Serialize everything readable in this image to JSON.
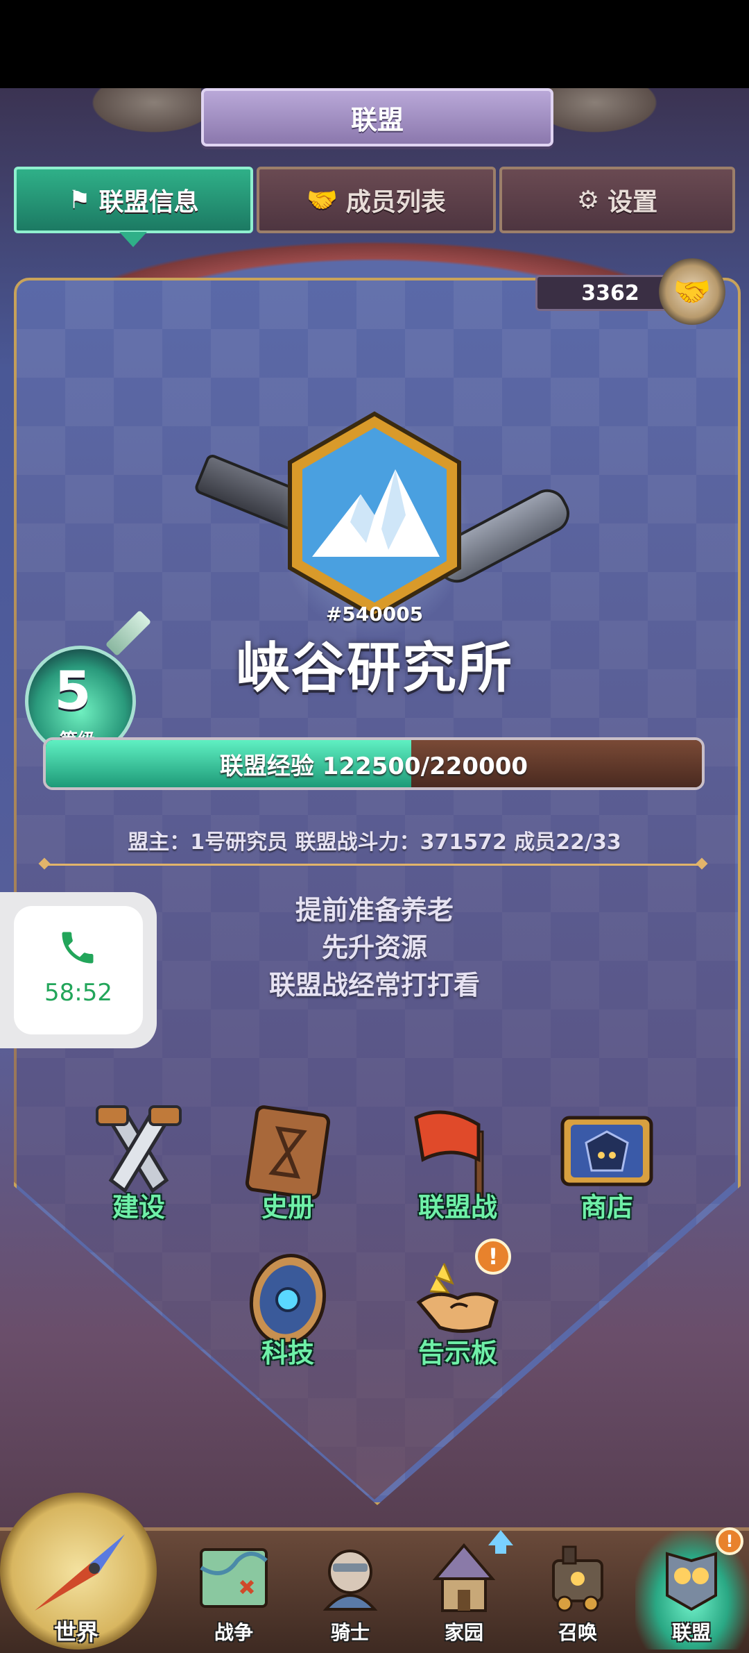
{
  "header": {
    "title": "联盟"
  },
  "tabs": [
    {
      "label": "联盟信息",
      "icon": "flag-icon",
      "active": true
    },
    {
      "label": "成员列表",
      "icon": "handshake-icon",
      "active": false
    },
    {
      "label": "设置",
      "icon": "gear-icon",
      "active": false
    }
  ],
  "power": {
    "value": "3362"
  },
  "guild": {
    "id": "#540005",
    "name": "峡谷研究所",
    "level": "5",
    "level_label": "等级",
    "exp_text": "联盟经验 122500/220000",
    "exp_fraction": 0.557,
    "info_line": "盟主：1号研究员  联盟战斗力：371572 成员22/33"
  },
  "announcement": [
    "提前准备养老",
    "先升资源",
    "联盟战经常打打看"
  ],
  "call_widget": {
    "timer": "58:52",
    "icon": "phone-icon",
    "color": "#22a55a"
  },
  "features": [
    {
      "label": "建设",
      "icon": "saw-cross-icon"
    },
    {
      "label": "史册",
      "icon": "book-icon"
    },
    {
      "label": "联盟战",
      "icon": "red-flag-icon"
    },
    {
      "label": "商店",
      "icon": "shop-icon"
    },
    {
      "label": "科技",
      "icon": "tech-shield-icon"
    },
    {
      "label": "告示板",
      "icon": "handshake-icon",
      "alert": "!"
    }
  ],
  "bottom_nav": [
    {
      "label": "世界",
      "icon": "compass-icon"
    },
    {
      "label": "战争",
      "icon": "map-icon"
    },
    {
      "label": "骑士",
      "icon": "knight-icon"
    },
    {
      "label": "家园",
      "icon": "house-icon"
    },
    {
      "label": "召唤",
      "icon": "train-icon"
    },
    {
      "label": "联盟",
      "icon": "alliance-icon",
      "active": true,
      "alert": "!"
    }
  ],
  "colors": {
    "accent_green": "#2fb088",
    "feature_label": "#6ff0a8",
    "alert_orange": "#e8822c",
    "gold_line": "#e2b46a"
  }
}
